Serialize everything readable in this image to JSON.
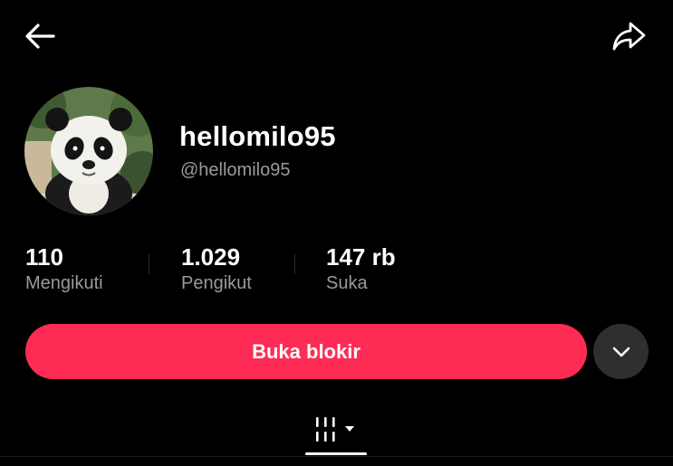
{
  "header": {
    "back_icon": "arrow-left-icon",
    "share_icon": "share-arrow-icon"
  },
  "profile": {
    "avatar_icon": "panda-avatar",
    "display_name": "hellomilo95",
    "handle": "@hellomilo95"
  },
  "stats": [
    {
      "value": "110",
      "label": "Mengikuti"
    },
    {
      "value": "1.029",
      "label": "Pengikut"
    },
    {
      "value": "147 rb",
      "label": "Suka"
    }
  ],
  "actions": {
    "unblock_label": "Buka blokir",
    "more_icon": "chevron-down-icon"
  },
  "tabs": {
    "active": "videos-grid-icon",
    "dropdown_icon": "caret-down-icon"
  },
  "colors": {
    "background": "#000000",
    "accent": "#fe2c55",
    "secondary_text": "#9a9a9e",
    "more_button_bg": "#2f2f31"
  }
}
